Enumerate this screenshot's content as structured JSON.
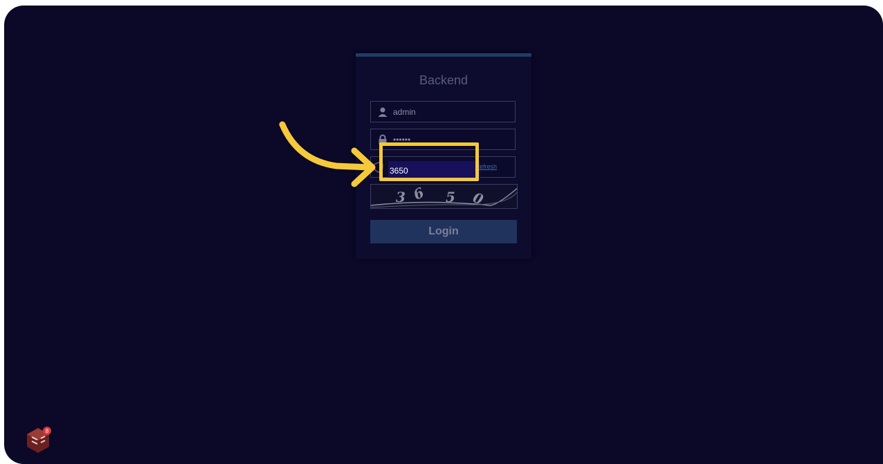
{
  "login": {
    "title": "Backend",
    "username_value": "admin",
    "password_value": "••••••",
    "captcha_value": "3650",
    "refresh_label": "Refresh",
    "captcha_chars": [
      "3",
      "6",
      "5",
      "0"
    ],
    "login_label": "Login"
  },
  "icons": {
    "user": "user-icon",
    "lock": "lock-icon",
    "shield": "shield-icon",
    "arrow": "arrow-icon",
    "app": "app-logo-icon"
  },
  "badge": {
    "count": "8"
  },
  "colors": {
    "background": "#0b0828",
    "highlight": "#f5c93a",
    "button": "#1f335d",
    "input_active": "#18105a"
  }
}
